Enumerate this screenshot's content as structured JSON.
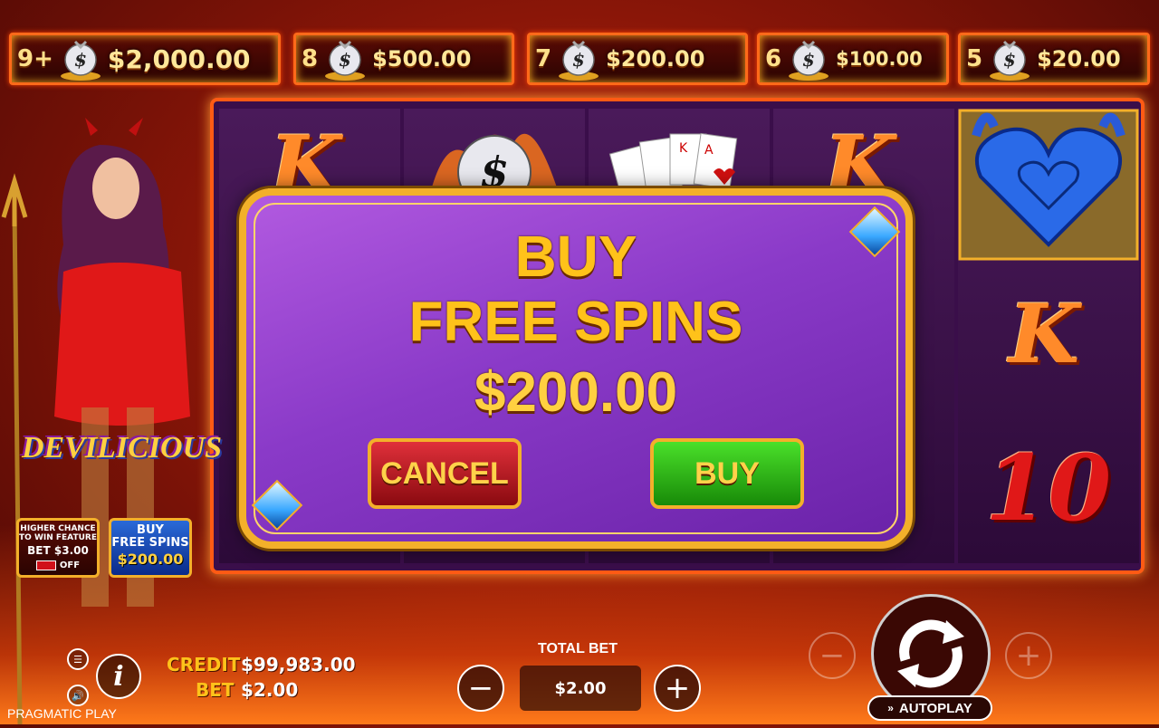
{
  "jackpots": [
    {
      "count": "9+",
      "amount": "$2,000.00"
    },
    {
      "count": "8",
      "amount": "$500.00"
    },
    {
      "count": "7",
      "amount": "$200.00"
    },
    {
      "count": "6",
      "amount": "$100.00"
    },
    {
      "count": "5",
      "amount": "$20.00"
    }
  ],
  "reels": {
    "k_symbol": "K",
    "ten_symbol": "10"
  },
  "modal": {
    "title_line1": "BUY",
    "title_line2": "FREE SPINS",
    "price": "$200.00",
    "cancel_label": "CANCEL",
    "buy_label": "BUY"
  },
  "game": {
    "logo": "DEVILICIOUS"
  },
  "side_buttons": {
    "feature_line1": "HIGHER CHANCE",
    "feature_line2": "TO WIN FEATURE",
    "feature_bet": "BET $3.00",
    "feature_state": "OFF",
    "buy_line1": "BUY",
    "buy_line2": "FREE SPINS",
    "buy_price": "$200.00"
  },
  "footer": {
    "credit_label": "CREDIT",
    "credit_value": "$99,983.00",
    "bet_label": "BET",
    "bet_value": "$2.00",
    "brand": "PRAGMATIC PLAY",
    "total_bet_label": "TOTAL BET",
    "total_bet_value": "$2.00",
    "minus": "−",
    "plus": "+",
    "autoplay_label": "AUTOPLAY",
    "info": "i"
  },
  "colors": {
    "gold": "#ffc21a",
    "frame_orange": "#ff5a14",
    "modal_purple": "#8a3ac8",
    "cancel_red": "#c01820",
    "buy_green": "#2aa814"
  }
}
